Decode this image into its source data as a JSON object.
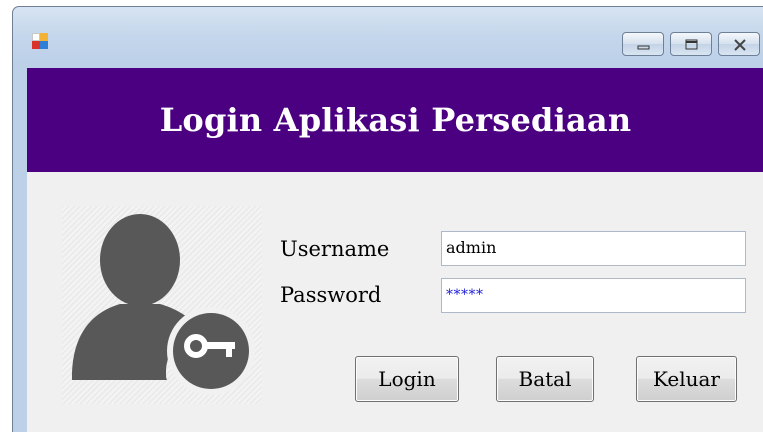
{
  "window": {
    "icon": "app-icon",
    "controls": [
      "minimize-icon",
      "maximize-icon",
      "close-icon"
    ]
  },
  "banner": {
    "title": "Login Aplikasi Persediaan",
    "color": "#4b0082"
  },
  "form": {
    "username_label": "Username",
    "username_value": "admin",
    "password_label": "Password",
    "password_value": "*****",
    "avatar_icon": "user-key-icon"
  },
  "buttons": {
    "login": "Login",
    "cancel": "Batal",
    "exit": "Keluar"
  }
}
